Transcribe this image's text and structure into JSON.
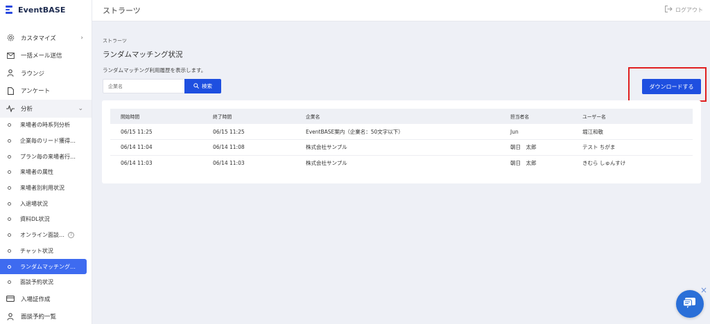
{
  "app": {
    "name": "EventBASE"
  },
  "sidebar": {
    "items": [
      {
        "label": "カスタマイズ",
        "icon": "gear-icon"
      },
      {
        "label": "一括メール送信",
        "icon": "mail-icon"
      },
      {
        "label": "ラウンジ",
        "icon": "person-icon"
      },
      {
        "label": "アンケート",
        "icon": "document-icon"
      },
      {
        "label": "分析",
        "icon": "pulse-icon"
      }
    ],
    "sub_items": [
      "来場者の時系列分析",
      "企業毎のリード獲得…",
      "プラン毎の来場者行…",
      "来場者の属性",
      "来場者別利用状況",
      "入退場状況",
      "資料DL状況",
      "オンライン面談…",
      "チャット状況",
      "ランダムマッチング…",
      "面談予約状況"
    ],
    "bottom_items": [
      {
        "label": "入場証作成",
        "icon": "card-icon"
      },
      {
        "label": "面談予約一覧",
        "icon": "person-icon"
      }
    ]
  },
  "header": {
    "title": "ストラーツ",
    "logout_label": "ログアウト"
  },
  "main": {
    "breadcrumb": "ストラーツ",
    "title": "ランダムマッチング状況",
    "description": "ランダムマッチング利用履歴を表示します。",
    "search": {
      "placeholder": "企業名",
      "button_label": "検索"
    },
    "download_label": "ダウンロードする",
    "table": {
      "columns": [
        "開始時間",
        "終了時間",
        "企業名",
        "担当者名",
        "ユーザー名"
      ],
      "rows": [
        [
          "06/15 11:25",
          "06/15 11:25",
          "EventBASE案内（企業名：50文字以下）",
          "Jun",
          "堀江和敬"
        ],
        [
          "06/14 11:04",
          "06/14 11:08",
          "株式会社サンプル",
          "朝日　太郎",
          "テスト ちがま"
        ],
        [
          "06/14 11:03",
          "06/14 11:03",
          "株式会社サンプル",
          "朝日　太郎",
          "きむら しゅんすけ"
        ]
      ]
    }
  },
  "colors": {
    "accent": "#1e4fe0",
    "active_nav": "#3e6bf0",
    "highlight_frame": "#e02020"
  }
}
